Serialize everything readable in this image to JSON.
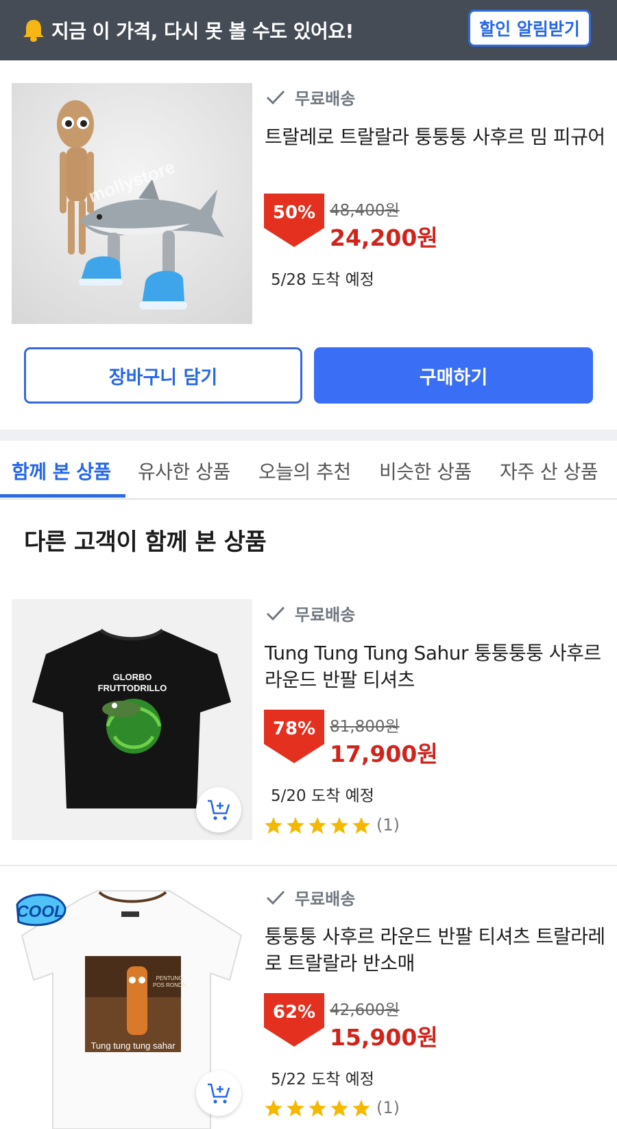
{
  "banner": {
    "text": "지금 이 가격, 다시 못 볼 수도 있어요!",
    "alert_button": "할인 알림받기"
  },
  "main_product": {
    "image_alt": "트랄레로 트랄랄라 피규어",
    "watermark": "mollystore",
    "shipping": "무료배송",
    "title": "트랄레로 트랄랄라 퉁퉁퉁 사후르 밈 피규어",
    "discount": "50%",
    "original_price": "48,400원",
    "price": "24,200원",
    "delivery": "5/28 도착 예정"
  },
  "actions": {
    "cart_label": "장바구니 담기",
    "buy_label": "구매하기"
  },
  "tabs": [
    "함께 본 상품",
    "유사한 상품",
    "오늘의 추천",
    "비슷한 상품",
    "자주 산 상품"
  ],
  "section_title": "다른 고객이 함께 본 상품",
  "recommendations": [
    {
      "shipping": "무료배송",
      "title": "Tung Tung Tung Sahur 퉁퉁퉁퉁 사후르 라운드 반팔 티셔츠",
      "discount": "78%",
      "original_price": "81,800원",
      "price": "17,900원",
      "delivery": "5/20 도착 예정",
      "rating": 5,
      "review_count": "(1)",
      "shirt_print": [
        "GLORBO",
        "FRUTTODRILLO"
      ]
    },
    {
      "shipping": "무료배송",
      "title": "퉁퉁퉁 사후르 라운드 반팔 티셔츠 트랄라레로 트랄랄라 반소매",
      "discount": "62%",
      "original_price": "42,600원",
      "price": "15,900원",
      "delivery": "5/22 도착 예정",
      "rating": 5,
      "review_count": "(1)",
      "sticker": "COOL",
      "shirt_caption": "Tung tung tung sahar",
      "shirt_sign": [
        "PENTUNG",
        "POS RONDA"
      ]
    }
  ],
  "colors": {
    "accent": "#2f6be0",
    "buy_button": "#3a6ef5",
    "price_red": "#d0241b",
    "badge_red": "#e3301f",
    "banner_bg": "#454c56",
    "star": "#f5b800"
  }
}
